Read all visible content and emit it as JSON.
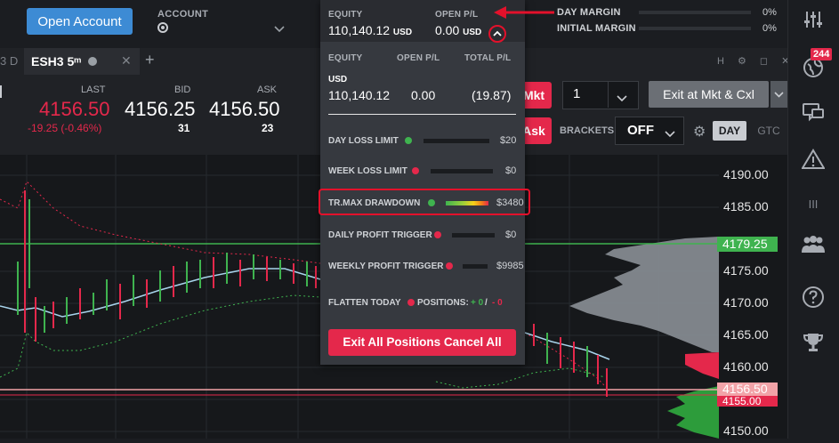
{
  "topbar": {
    "open_account_label": "Open Account",
    "account_label": "ACCOUNT",
    "day_margin_label": "DAY MARGIN",
    "day_margin_pct": "0%",
    "initial_margin_label": "INITIAL MARGIN",
    "initial_margin_pct": "0%"
  },
  "tabs": {
    "partial_label": "3 D",
    "active_label": "ESH3 5ᵐ",
    "close_glyph": "✕",
    "add_glyph": "+",
    "tool_glyphs": "H ⚙ ◻ ✕"
  },
  "quote": {
    "last_label": "LAST",
    "last_value": "4156.50",
    "last_change": "-19.25 (-0.46%)",
    "bid_label": "BID",
    "bid_value": "4156.25",
    "bid_size": "31",
    "ask_label": "ASK",
    "ask_value": "4156.50",
    "ask_size": "23"
  },
  "order": {
    "mkt_label": "Mkt",
    "ask_btn_label": "Ask",
    "qty_value": "1",
    "exit_label": "Exit at Mkt & Cxl",
    "brackets_label": "BRACKETS",
    "brackets_value": "OFF",
    "tif_day": "DAY",
    "tif_gtc": "GTC"
  },
  "price_axis": {
    "labels": [
      "4190.00",
      "4185.00",
      "4179.25",
      "4175.00",
      "4170.00",
      "4165.00",
      "4160.00",
      "4156.50",
      "4155.00",
      "4150.00"
    ]
  },
  "sidebar": {
    "badge": "244"
  },
  "dropdown": {
    "equity_label": "EQUITY",
    "equity_value": "110,140.12",
    "equity_ccy": "USD",
    "open_pl_label": "OPEN P/L",
    "open_pl_value": "0.00",
    "open_pl_ccy": "USD",
    "table_equity_label": "EQUITY",
    "table_open_pl_label": "OPEN P/L",
    "table_total_pl_label": "TOTAL P/L",
    "ccy_label": "USD",
    "table_equity_value": "110,140.12",
    "table_open_pl_value": "0.00",
    "table_total_pl_value": "(19.87)",
    "rows": [
      {
        "label": "DAY LOSS LIMIT",
        "amount": "$20",
        "dot": "#3fb34f"
      },
      {
        "label": "WEEK LOSS LIMIT",
        "amount": "$0",
        "dot": "#e4284b"
      },
      {
        "label": "TR.MAX DRAWDOWN",
        "amount": "$3480",
        "dot": "#3fb34f"
      },
      {
        "label": "DAILY PROFIT TRIGGER",
        "amount": "$0",
        "dot": "#e4284b"
      },
      {
        "label": "WEEKLY PROFIT TRIGGER",
        "amount": "$9985",
        "dot": "#e4284b"
      }
    ],
    "flatten_label": "FLATTEN TODAY",
    "positions_label": "POSITIONS:",
    "positions_plus": "+ 0",
    "positions_sep": "/",
    "positions_minus": "- 0",
    "exit_all_label": "Exit All Positions Cancel All"
  },
  "colors": {
    "accent_blue": "#3d8bd4",
    "red": "#e4284b",
    "green": "#3fb34f",
    "annotation": "#e3112b"
  }
}
